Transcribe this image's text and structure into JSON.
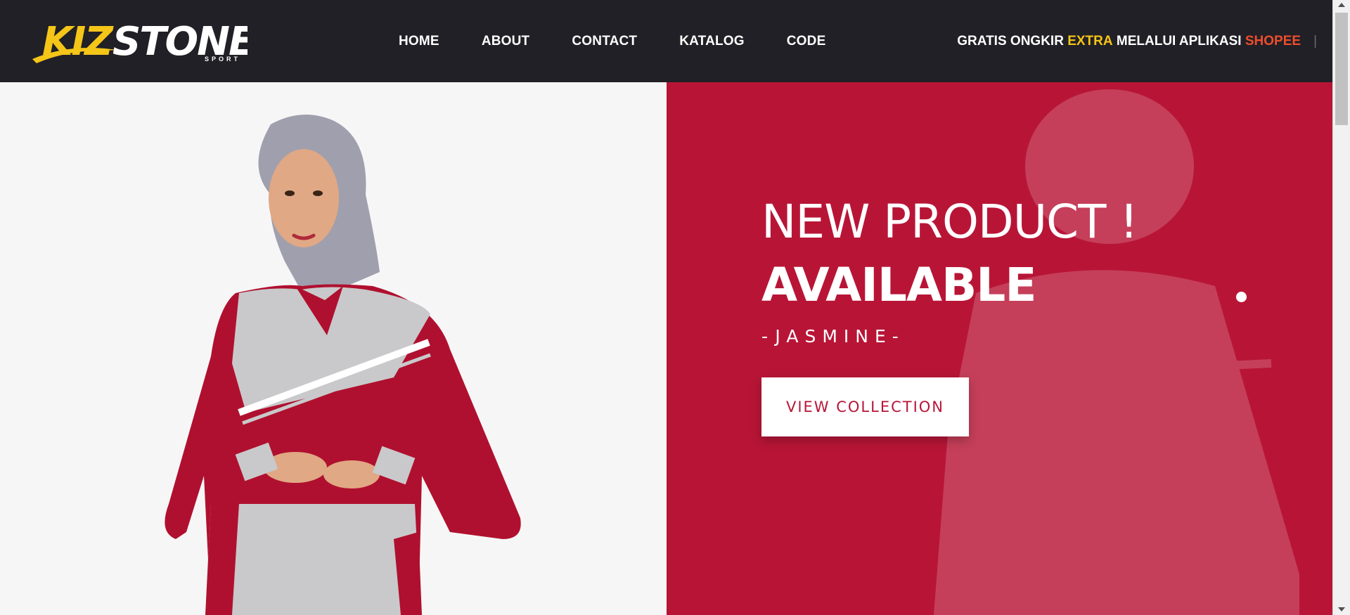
{
  "brand": {
    "logo_text_1": "KIZ",
    "logo_text_2": "STONE",
    "logo_sub": "SPORT",
    "colors": {
      "header_bg": "#212026",
      "logo_yellow": "#f5c518",
      "hero_red": "#b81536",
      "shopee_orange": "#ee4d2d"
    }
  },
  "nav": {
    "items": [
      {
        "label": "HOME"
      },
      {
        "label": "ABOUT"
      },
      {
        "label": "CONTACT"
      },
      {
        "label": "KATALOG"
      },
      {
        "label": "CODE"
      }
    ]
  },
  "promo": {
    "part1": "GRATIS ONGKIR ",
    "highlight": "EXTRA",
    "part2": " MELALUI APLIKASI ",
    "app": "SHOPEE",
    "separator": "|"
  },
  "hero": {
    "headline_1": "NEW PRODUCT !",
    "headline_2": "AVAILABLE",
    "subtitle": "-JASMINE-",
    "cta_label": "VIEW COLLECTION",
    "slider_active": 1
  }
}
